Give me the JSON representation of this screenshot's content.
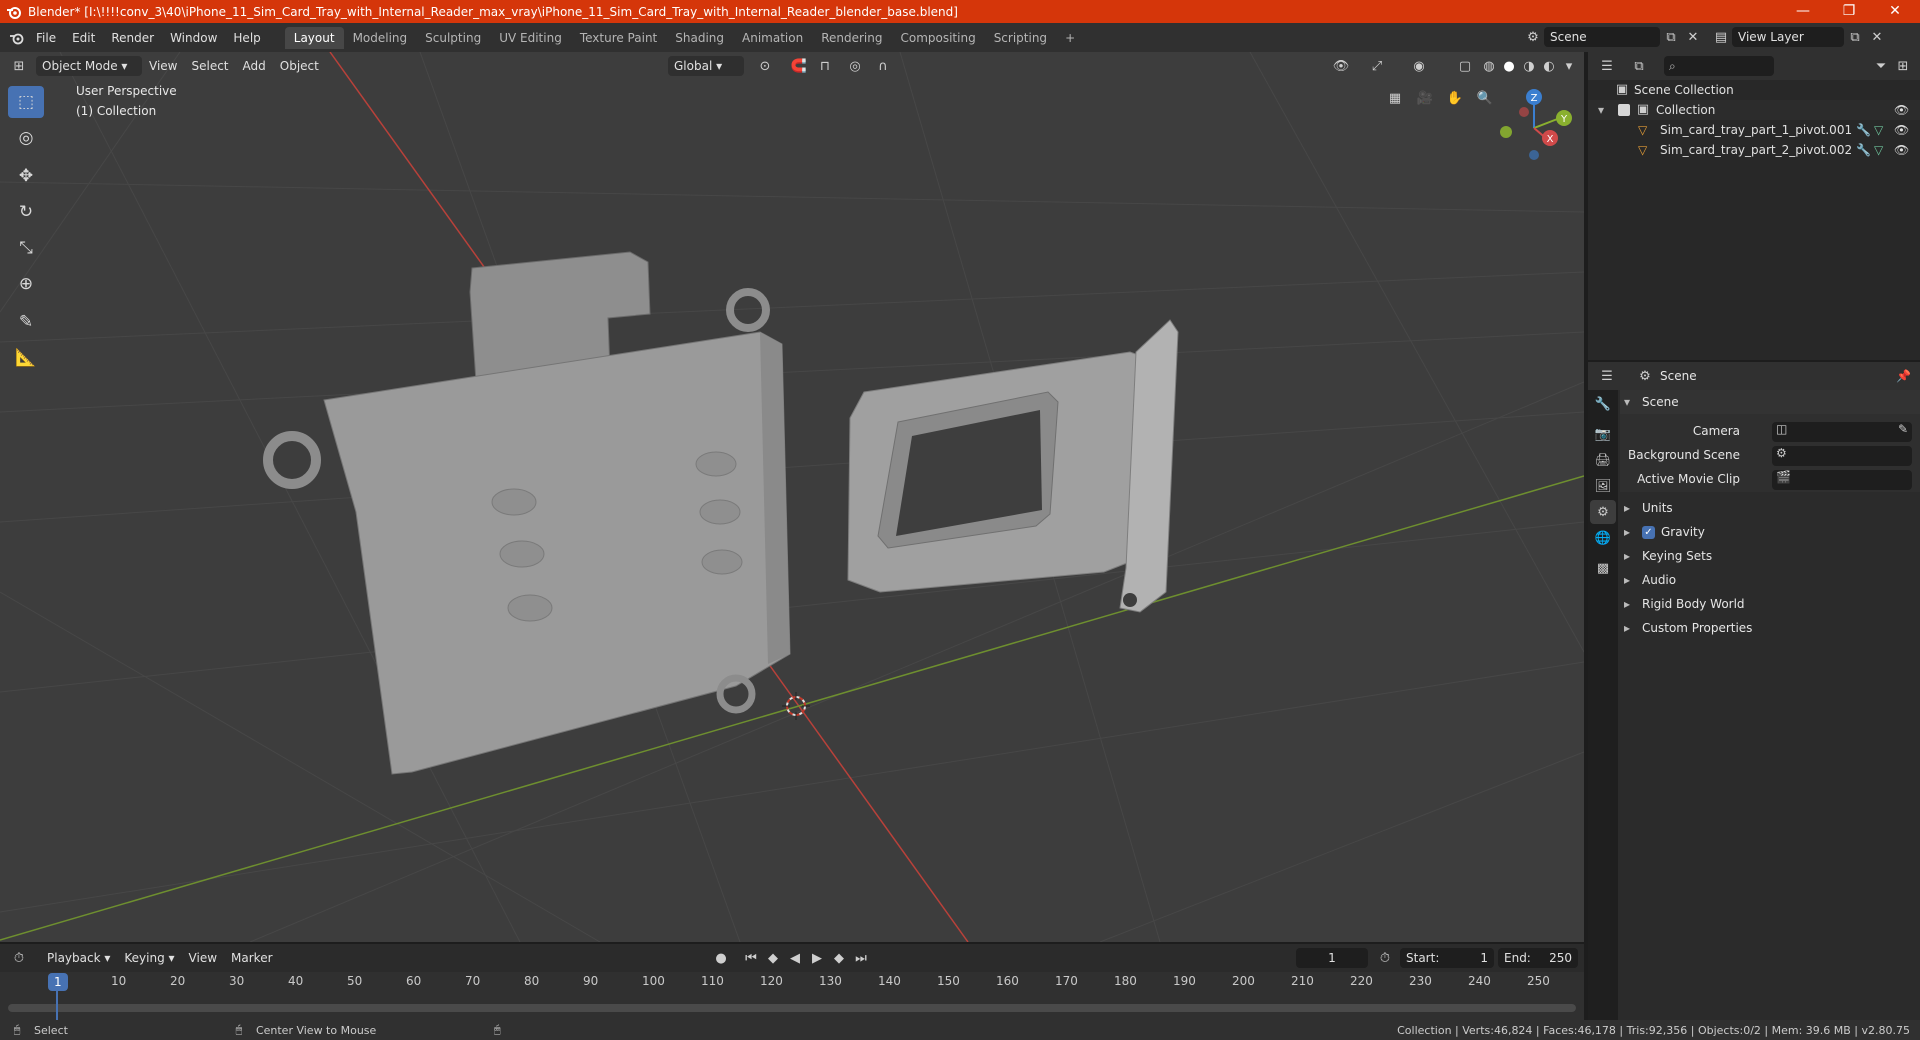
{
  "window": {
    "title": "Blender* [I:\\!!!!conv_3\\40\\iPhone_11_Sim_Card_Tray_with_Internal_Reader_max_vray\\iPhone_11_Sim_Card_Tray_with_Internal_Reader_blender_base.blend]",
    "minimize": "—",
    "maximize": "❐",
    "close": "✕"
  },
  "menubar": {
    "items": [
      "File",
      "Edit",
      "Render",
      "Window",
      "Help"
    ],
    "workspaces": [
      "Layout",
      "Modeling",
      "Sculpting",
      "UV Editing",
      "Texture Paint",
      "Shading",
      "Animation",
      "Rendering",
      "Compositing",
      "Scripting"
    ],
    "active_workspace": "Layout",
    "add_workspace": "+",
    "scene": "Scene",
    "view_layer": "View Layer"
  },
  "viewport": {
    "mode": "Object Mode",
    "menus": [
      "View",
      "Select",
      "Add",
      "Object"
    ],
    "orientation": "Global",
    "overlay_text": "User Perspective",
    "overlay_collection": "(1) Collection",
    "gizmo": {
      "x": "X",
      "y": "Y",
      "z": "Z"
    }
  },
  "outliner": {
    "search_placeholder": "",
    "root": "Scene Collection",
    "collection": "Collection",
    "objects": [
      "Sim_card_tray_part_1_pivot.001",
      "Sim_card_tray_part_2_pivot.002"
    ]
  },
  "properties": {
    "header": "Scene",
    "panel_title": "Scene",
    "camera_label": "Camera",
    "background_scene_label": "Background Scene",
    "active_movie_clip_label": "Active Movie Clip",
    "sections": [
      "Units",
      "Gravity",
      "Keying Sets",
      "Audio",
      "Rigid Body World",
      "Custom Properties"
    ],
    "gravity_checked": true
  },
  "timeline": {
    "menus": [
      "Playback",
      "Keying",
      "View",
      "Marker"
    ],
    "current_frame": "1",
    "start_label": "Start:",
    "start": "1",
    "end_label": "End:",
    "end": "250",
    "ruler_ticks": [
      "1",
      "10",
      "20",
      "30",
      "40",
      "50",
      "60",
      "70",
      "80",
      "90",
      "100",
      "110",
      "120",
      "130",
      "140",
      "150",
      "160",
      "170",
      "180",
      "190",
      "200",
      "210",
      "220",
      "230",
      "240",
      "250"
    ]
  },
  "statusbar": {
    "select": "Select",
    "center_view": "Center View to Mouse",
    "stats": "Collection | Verts:46,824 | Faces:46,178 | Tris:92,356 | Objects:0/2 | Mem: 39.6 MB | v2.80.75"
  },
  "colors": {
    "accent": "#4772b3",
    "titlebar": "#d5360a",
    "viewport_bg": "#3d3d3d",
    "x_axis": "#c0392b",
    "y_axis": "#7aa33a"
  }
}
